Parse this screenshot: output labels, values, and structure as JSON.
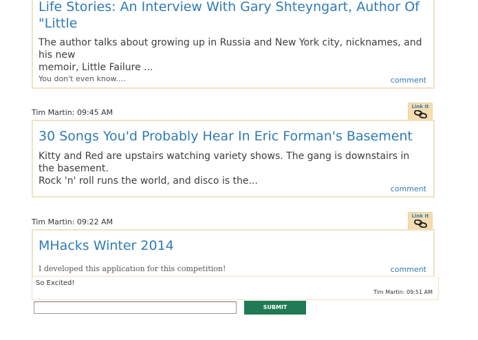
{
  "posts": [
    {
      "title_line1": "Life Stories: An Interview With Gary Shteyngart, Author Of",
      "title_line2": "\"Little",
      "description_line1": "The author talks about growing up in Russia and New York city, nicknames, and his new",
      "description_line2": "memoir, Little Failure ...",
      "note": "You don't even know....",
      "comment_label": "comment"
    },
    {
      "meta": "Tim Martin: 09:45 AM",
      "link_it_label": "Link It",
      "title": "30 Songs You'd Probably Hear In Eric Forman's Basement",
      "description_line1": "Kitty and Red are upstairs watching variety shows. The gang is downstairs in the basement.",
      "description_line2": "Rock 'n' roll runs the world, and disco is the...",
      "comment_label": "comment"
    },
    {
      "meta": "Tim Martin: 09:22 AM",
      "link_it_label": "Link It",
      "title": "MHacks Winter 2014",
      "note": "I developed this application for this competition!",
      "comment_label": "comment",
      "comments": [
        {
          "text": "So Excited!",
          "meta": "Tim Martin: 09:51 AM"
        }
      ]
    }
  ],
  "comment_form": {
    "input_value": "",
    "input_placeholder": "",
    "submit_label": "SUBMIT"
  },
  "colors": {
    "title": "#2f7bb5",
    "border": "#efe2c1",
    "link_it_bg": "#f5ddb0",
    "submit_bg": "#1f7a55"
  }
}
